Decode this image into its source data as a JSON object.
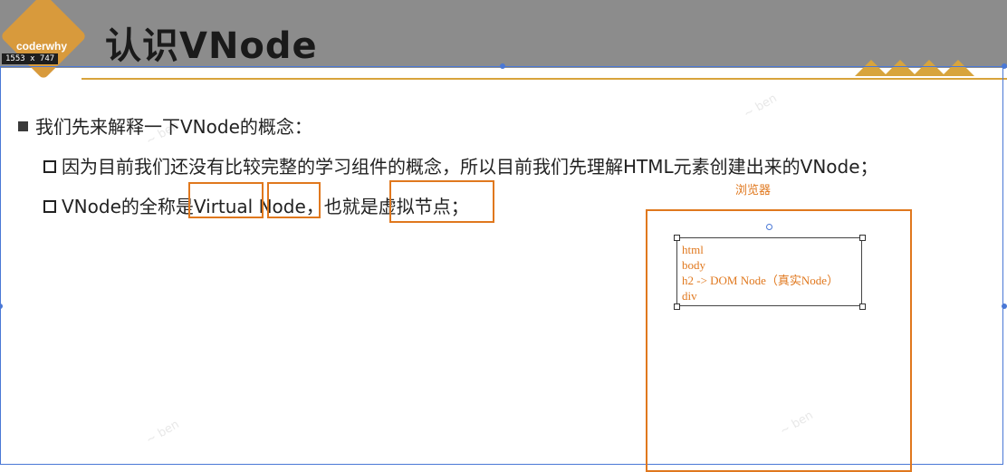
{
  "header": {
    "logo_text": "coderwhy",
    "size_badge": "1553 x 747",
    "title": "认识VNode"
  },
  "content": {
    "bullet_main": "我们先来解释一下VNode的概念：",
    "sub1": "因为目前我们还没有比较完整的学习组件的概念，所以目前我们先理解HTML元素创建出来的VNode；",
    "sub2_parts": [
      "VNode的全称是",
      "Virtual Node",
      "，也就是",
      "虚拟节点",
      "；"
    ]
  },
  "diagram": {
    "browser_label": "浏览器",
    "dom_lines": [
      "html",
      "body",
      "h2 -> DOM Node（真实Node）",
      "div"
    ]
  },
  "colors": {
    "accent_orange": "#e0781e",
    "gold": "#d8a43c",
    "header_gray": "#8c8c8c",
    "selection_blue": "#4a78d6"
  }
}
